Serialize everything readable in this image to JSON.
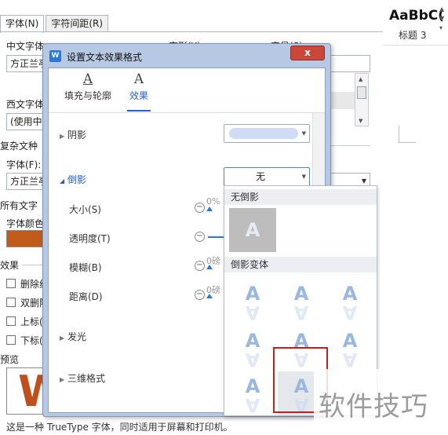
{
  "font_dialog": {
    "tabs": [
      {
        "label": "字体(N)",
        "active": true
      },
      {
        "label": "字符间距(R)",
        "active": false
      }
    ],
    "chinese_font_label": "中文字体(T)",
    "chinese_font_value": "方正兰亭",
    "style_label": "字形(Y)",
    "size_label": "字号(S)",
    "western_font_label": "西文字体",
    "western_font_value": "(使用中",
    "complex_font_label": "复杂文种",
    "font_f_label": "字体(F):",
    "font_f_value": "方正兰亭",
    "all_text_label": "所有文字",
    "font_color_label": "字体颜色",
    "effects_label": "效果",
    "effects": [
      {
        "label": "删除线"
      },
      {
        "label": "双删除"
      },
      {
        "label": "上标("
      },
      {
        "label": "下标("
      }
    ],
    "preview_label": "预览",
    "preview_letter": "W",
    "bottom_note": "这是一种 TrueType 字体，同时适用于屏幕和打印机。",
    "colors": {
      "font_color": "#c05b1c"
    }
  },
  "style_gallery": {
    "sample": "AaBbC(",
    "name": "标题 3"
  },
  "effect_dialog": {
    "title": "设置文本效果格式",
    "app_icon": "W",
    "close_label": "x",
    "tabs": [
      {
        "label": "填充与轮廓",
        "icon": "A",
        "active": false
      },
      {
        "label": "效果",
        "icon": "A",
        "active": true
      }
    ],
    "sections": {
      "shadow": {
        "label": "阴影"
      },
      "reflection": {
        "label": "倒影",
        "value": "无"
      },
      "glow": {
        "label": "发光"
      },
      "three_d": {
        "label": "三维格式"
      }
    },
    "reflection_rows": [
      {
        "label": "大小(S)",
        "value": "0%"
      },
      {
        "label": "透明度(T)",
        "value": ""
      },
      {
        "label": "模糊(B)",
        "value": "0磅"
      },
      {
        "label": "距离(D)",
        "value": "0磅"
      }
    ]
  },
  "reflection_popup": {
    "no_reflection_header": "无倒影",
    "variants_header": "倒影变体",
    "tile_letter": "A"
  },
  "watermark": "软件技巧"
}
